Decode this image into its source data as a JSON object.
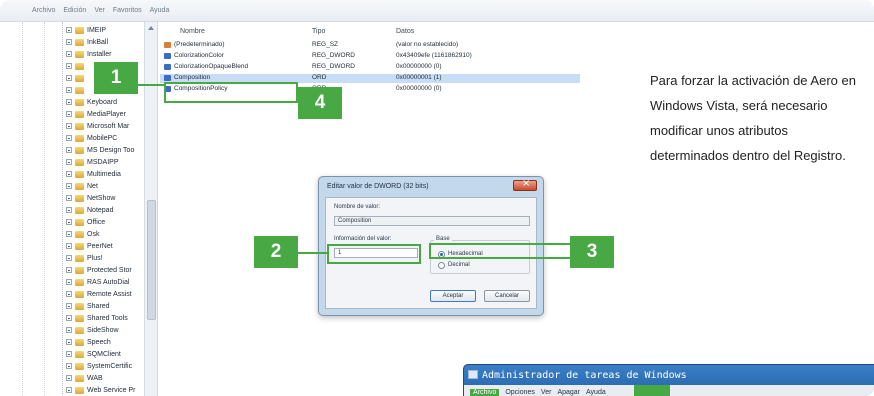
{
  "regedit": {
    "menu": [
      "Archivo",
      "Edición",
      "Ver",
      "Favoritos",
      "Ayuda"
    ],
    "tree_items": [
      "IMEIP",
      "InkBall",
      "Installer",
      "",
      "",
      "",
      "Keyboard",
      "MediaPlayer",
      "Microsoft Mar",
      "MobilePC",
      "MS Design Too",
      "MSDAIPP",
      "Multimedia",
      "Net",
      "NetShow",
      "Notepad",
      "Office",
      "Osk",
      "PeerNet",
      "Plus!",
      "Protected Stor",
      "RAS AutoDial",
      "Remote Assist",
      "Shared",
      "Shared Tools",
      "SideShow",
      "Speech",
      "SQMClient",
      "SystemCertific",
      "WAB",
      "Web Service Pr"
    ],
    "columns": {
      "name": "Nombre",
      "type": "Tipo",
      "data": "Datos"
    },
    "values": [
      {
        "name": "(Predeterminado)",
        "type": "REG_SZ",
        "data": "(valor no establecido)",
        "kind": "sz"
      },
      {
        "name": "ColorizationColor",
        "type": "REG_DWORD",
        "data": "0x43409efe (1161862910)",
        "kind": "dword"
      },
      {
        "name": "ColorizationOpaqueBlend",
        "type": "REG_DWORD",
        "data": "0x00000000 (0)",
        "kind": "dword"
      },
      {
        "name": "Composition",
        "type": "ORD",
        "data": "0x00000001 (1)",
        "kind": "dword"
      },
      {
        "name": "CompositionPolicy",
        "type": "ORD",
        "data": "0x00000000 (0)",
        "kind": "dword"
      }
    ]
  },
  "dialog": {
    "title": "Editar valor de DWORD (32 bits)",
    "name_label": "Nombre de valor:",
    "name_value": "Composition",
    "info_label": "Información del valor:",
    "info_value": "1",
    "base_label": "Base",
    "radio_hex": "Hexadecimal",
    "radio_dec": "Decimal",
    "accept": "Aceptar",
    "cancel": "Cancelar"
  },
  "badges": {
    "b1": "1",
    "b2": "2",
    "b3": "3",
    "b4": "4"
  },
  "callout": {
    "text": "Para forzar la activación de Aero en Windows Vista, será necesario modificar unos atributos determinados dentro del Registro."
  },
  "taskmgr": {
    "title": "Administrador de tareas de Windows",
    "menu": [
      "Archivo",
      "Opciones",
      "Ver",
      "Apagar",
      "Ayuda"
    ]
  },
  "colors": {
    "accent_green": "#48a843",
    "window_blue": "#1f5ea3"
  }
}
